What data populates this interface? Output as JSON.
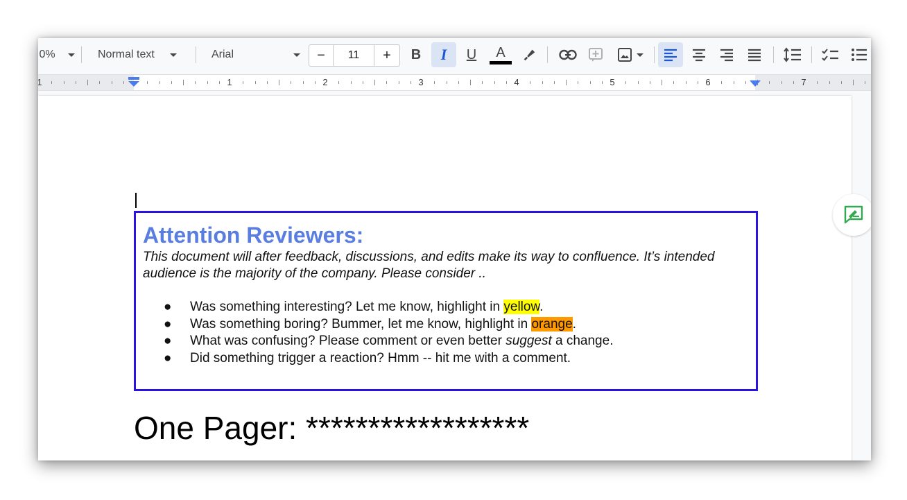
{
  "toolbar": {
    "zoom": "0%",
    "style": "Normal text",
    "font": "Arial",
    "font_size": "11",
    "decrease": "−",
    "increase": "+",
    "bold": "B",
    "italic": "I",
    "underline": "U",
    "text_color": "A",
    "text_color_value": "#000000"
  },
  "ruler": {
    "numbers": [
      "1",
      "1",
      "2",
      "3",
      "4",
      "5",
      "6",
      "7"
    ]
  },
  "document": {
    "review_title": "Attention Reviewers:",
    "review_intro": "This document will after feedback, discussions, and edits make its way to confluence. It’s intended audience is the majority of the company. Please consider ..",
    "bullets": [
      {
        "before": "Was something interesting? Let me know, highlight in ",
        "highlight": "yellow",
        "after": "."
      },
      {
        "before": "Was something boring? Bummer, let me know, highlight in ",
        "highlight": "orange",
        "after": "."
      },
      {
        "before": "What was confusing? Please comment or even better ",
        "emphasis": "suggest",
        "after": " a change."
      },
      {
        "before": "Did something trigger a reaction? Hmm -- hit me with a comment.",
        "after": ""
      }
    ],
    "one_pager": "One Pager: ******************"
  },
  "colors": {
    "box_border": "#2b13e3",
    "title_color": "#5a7de0",
    "yellow_highlight": "#ffff00",
    "orange_highlight": "#ff9900",
    "active_button": "#dbe4f5"
  },
  "icons": [
    "highlighter-icon",
    "link-icon",
    "add-comment-icon",
    "insert-image-icon",
    "align-left-icon",
    "align-center-icon",
    "align-right-icon",
    "align-justify-icon",
    "line-spacing-icon",
    "checklist-icon",
    "bulleted-list-icon",
    "suggest-edits-icon"
  ]
}
